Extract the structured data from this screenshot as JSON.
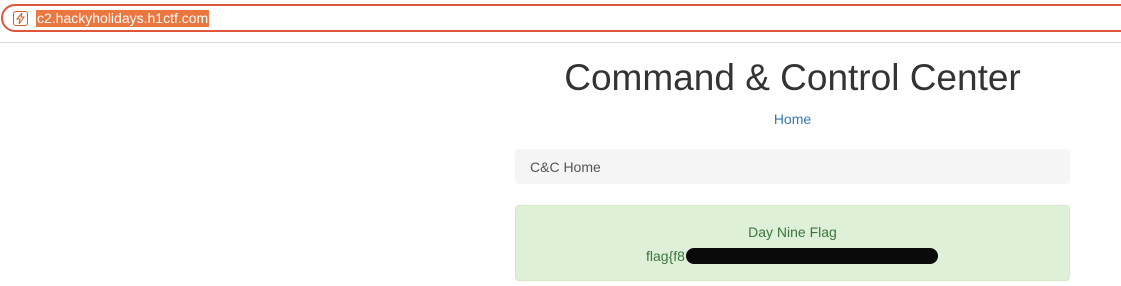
{
  "browser": {
    "url": "c2.hackyholidays.h1ctf.com",
    "site_icon": "lightning-page-icon"
  },
  "page": {
    "title": "Command & Control Center",
    "nav_home": "Home",
    "breadcrumb": "C&C Home",
    "alert": {
      "title": "Day Nine Flag",
      "flag_visible_prefix": "flag{f8"
    }
  },
  "colors": {
    "url_border": "#e0563b",
    "url_highlight": "#e9773f",
    "link": "#337ab7",
    "alert_bg": "#dff0d8",
    "alert_text": "#3c763d",
    "breadcrumb_bg": "#f5f5f5"
  }
}
